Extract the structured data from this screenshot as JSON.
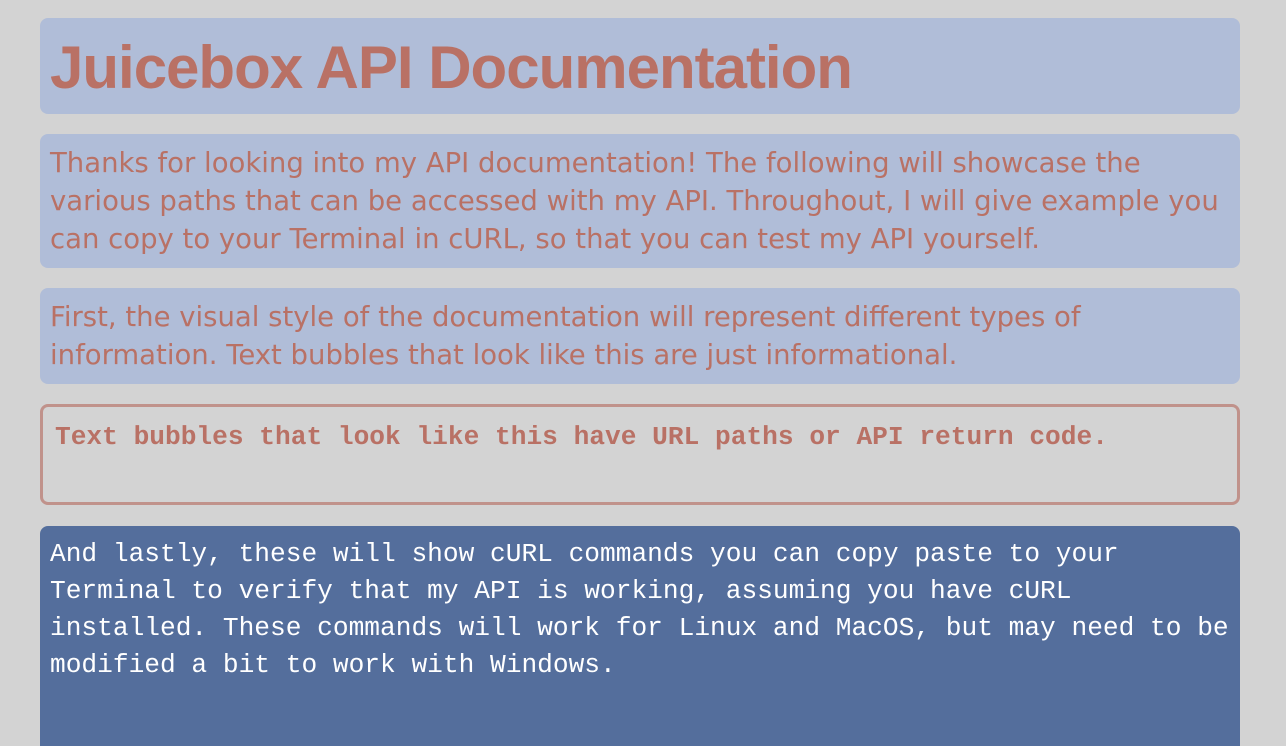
{
  "page": {
    "title": "Juicebox API Documentation"
  },
  "sections": {
    "intro": "Thanks for looking into my API documentation! The following will showcase the various paths that can be accessed with my API. Throughout, I will give example you can copy to your Terminal in cURL, so that you can test my API yourself.",
    "style_note": "First, the visual style of the documentation will represent different types of information. Text bubbles that look like this are just informational.",
    "code_note": "Text bubbles that look like this have URL paths or API return code.",
    "curl_note": "And lastly, these will show cURL commands you can copy paste to your Terminal to verify that my API is working, assuming you have cURL installed. These commands will work for Linux and MacOS, but may need to be modified a bit to work with Windows."
  },
  "colors": {
    "page_background": "#d3d3d3",
    "info_bubble_background": "#b0bdd8",
    "text_accent": "#b97165",
    "code_border": "#c0928b",
    "curl_bubble_background": "#546e9c",
    "curl_text": "#ffffff"
  }
}
